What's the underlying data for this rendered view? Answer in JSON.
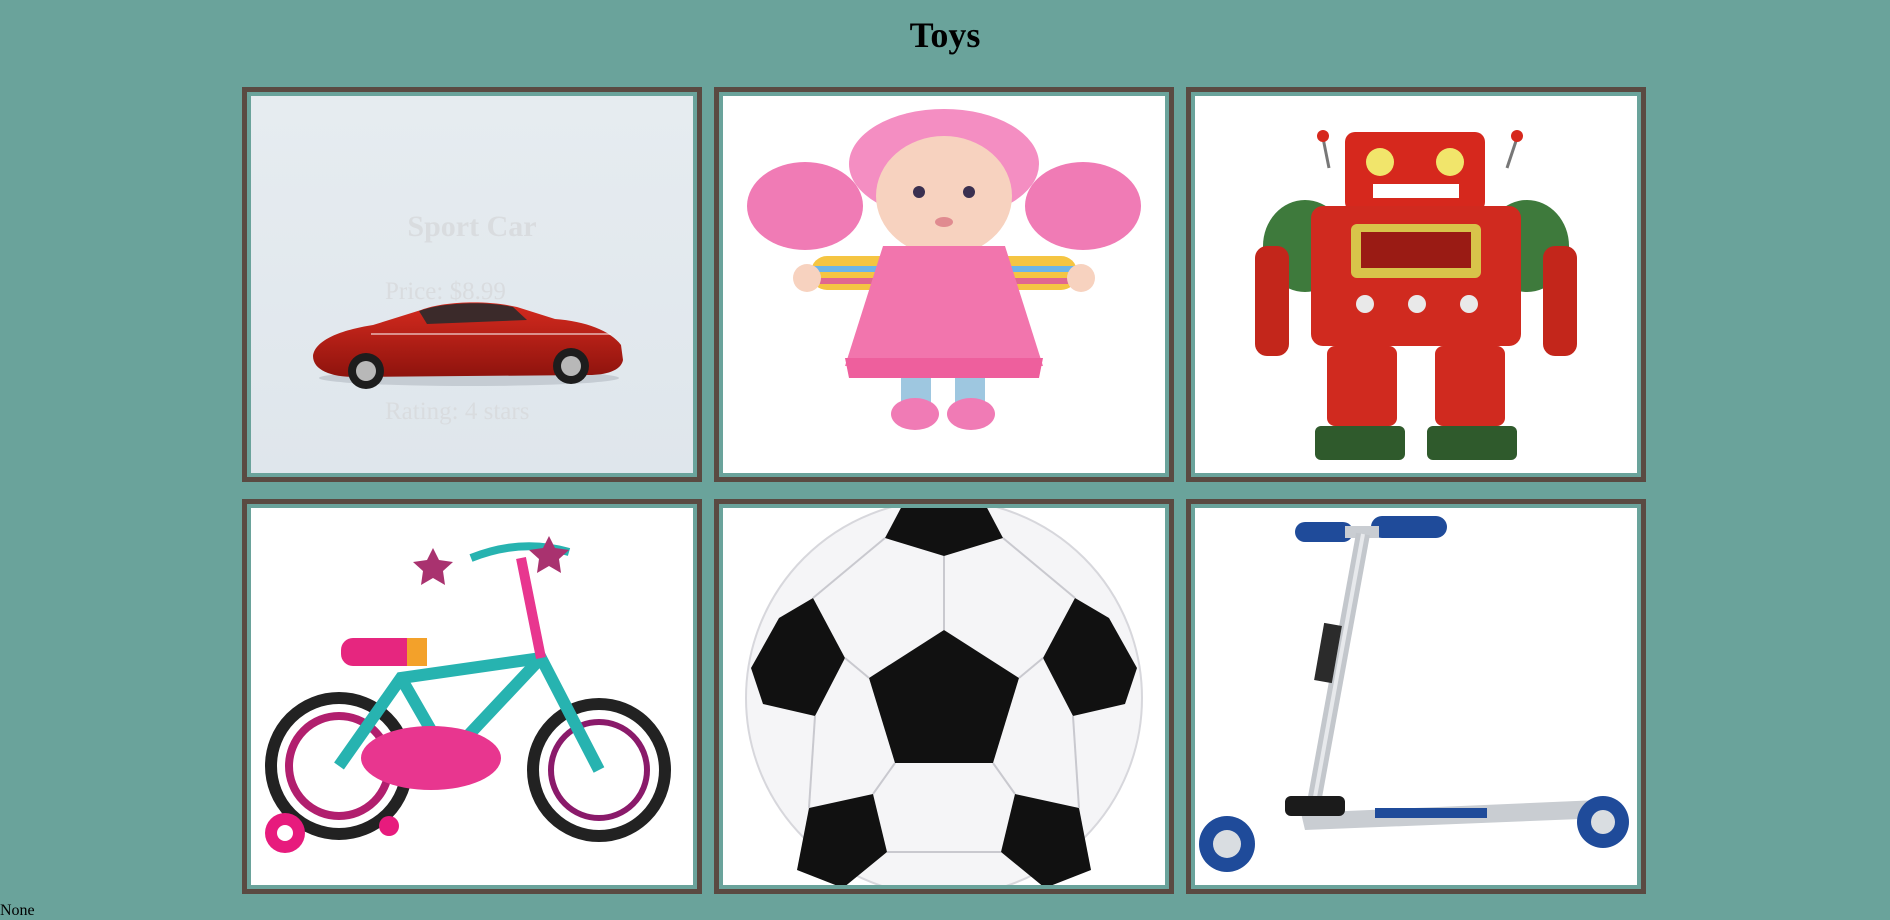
{
  "title": "Toys",
  "toys": [
    {
      "name": "Sport Car",
      "price": "Price: $8.99",
      "rating": "Rating: 4 stars",
      "image": "red-sport-car-image"
    },
    {
      "image": "pink-doll-image"
    },
    {
      "image": "red-tin-robot-image"
    },
    {
      "image": "kids-bicycle-image"
    },
    {
      "image": "soccer-ball-image"
    },
    {
      "image": "kick-scooter-image"
    }
  ],
  "footer": {
    "text": "None"
  },
  "colors": {
    "background": "#6aa39b",
    "card_border": "#5a4a42",
    "overlay_text": "#d9dcdf"
  }
}
